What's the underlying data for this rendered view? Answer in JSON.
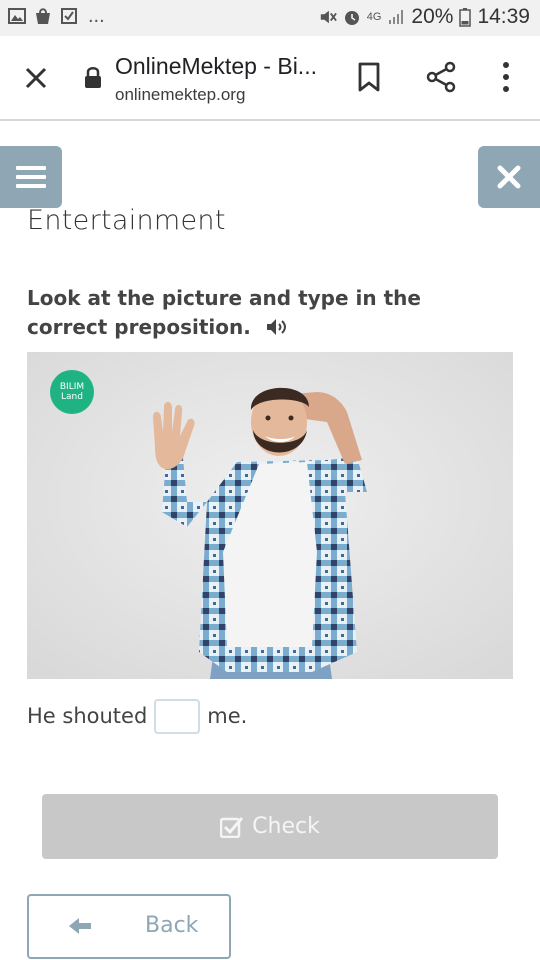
{
  "status_bar": {
    "overflow": "...",
    "network": "4G",
    "battery": "20%",
    "time": "14:39",
    "icons": [
      "image-icon",
      "bag-icon",
      "checkbox-icon",
      "mute-icon",
      "alarm-icon",
      "signal-icon",
      "battery-icon"
    ]
  },
  "browser": {
    "title": "OnlineMektep - Bi...",
    "url": "onlinemektep.org"
  },
  "page": {
    "section_title": "Entertainment",
    "instruction": "Look at the picture and type in the correct preposition.",
    "image": {
      "badge_line1": "BILIM",
      "badge_line2": "Land"
    },
    "sentence": {
      "before": "He shouted",
      "answer_value": "",
      "after": "me."
    },
    "check_label": "Check",
    "back_label": "Back"
  },
  "colors": {
    "accent": "#8fa6b4",
    "check_disabled": "#c8c8c8",
    "badge": "#1fb383"
  }
}
